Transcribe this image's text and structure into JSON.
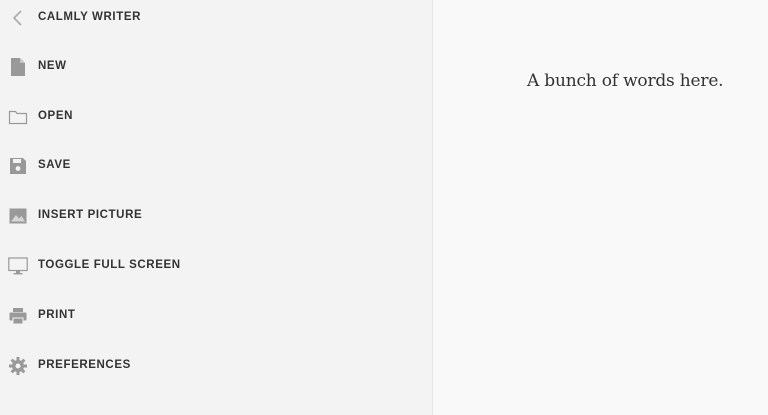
{
  "header": {
    "title": "CALMLY WRITER",
    "back_icon": "chevron-left-icon"
  },
  "menu": {
    "items": [
      {
        "label": "NEW",
        "icon": "document-icon"
      },
      {
        "label": "OPEN",
        "icon": "folder-icon"
      },
      {
        "label": "SAVE",
        "icon": "floppy-disk-icon"
      },
      {
        "label": "INSERT PICTURE",
        "icon": "image-icon"
      },
      {
        "label": "TOGGLE FULL SCREEN",
        "icon": "monitor-icon"
      },
      {
        "label": "PRINT",
        "icon": "printer-icon"
      },
      {
        "label": "PREFERENCES",
        "icon": "gear-icon"
      }
    ]
  },
  "editor": {
    "text": "A bunch of words here."
  },
  "colors": {
    "sidebar_bg": "#f3f3f3",
    "editor_bg": "#f9f9f9",
    "text": "#333333",
    "icon": "#999999"
  }
}
